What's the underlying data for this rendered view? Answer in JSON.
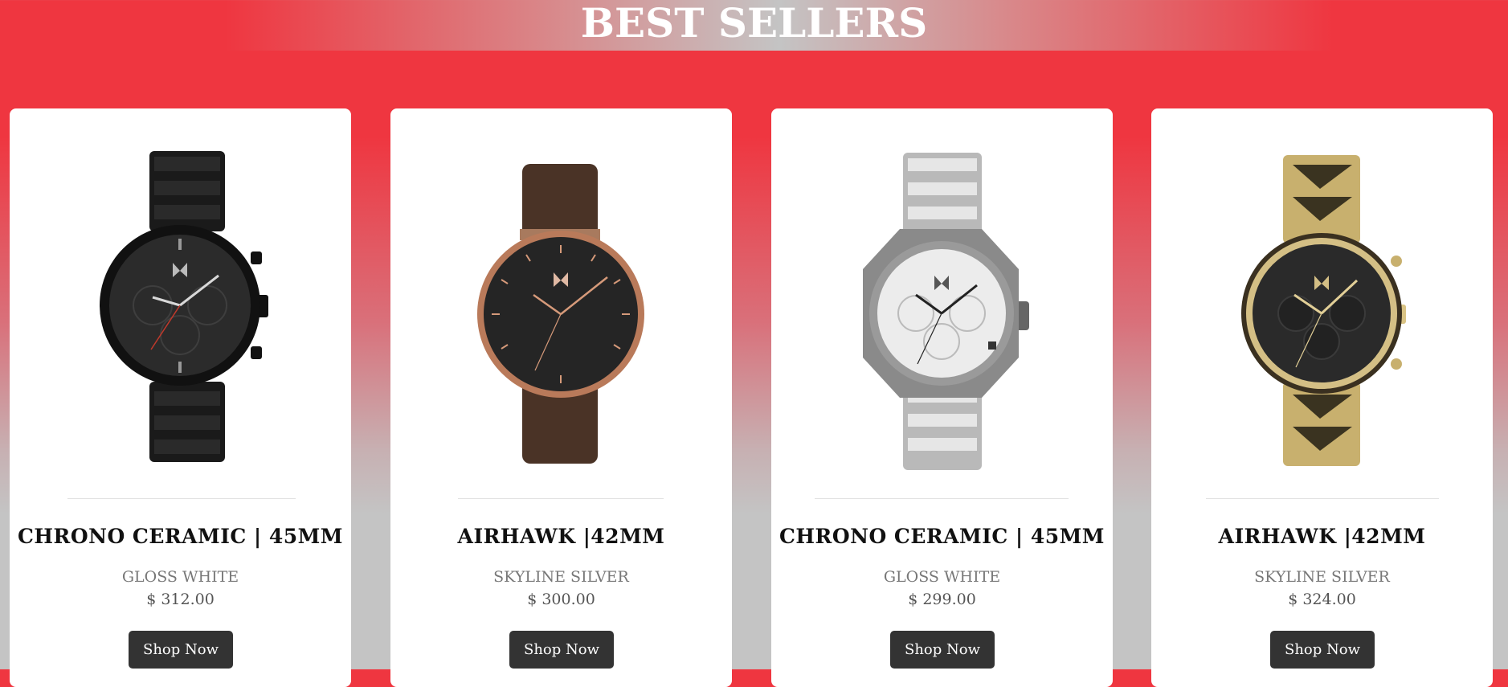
{
  "header": {
    "title": "BEST SELLERS"
  },
  "products": [
    {
      "name": "CHRONO CERAMIC | 45MM",
      "variant": "GLOSS WHITE",
      "price": "$ 312.00",
      "button": "Shop Now",
      "image": "black-chronograph-watch"
    },
    {
      "name": "AIRHAWK |42MM",
      "variant": "SKYLINE SILVER",
      "price": "$ 300.00",
      "button": "Shop Now",
      "image": "rose-gold-leather-watch"
    },
    {
      "name": "CHRONO CERAMIC | 45MM",
      "variant": "GLOSS WHITE",
      "price": "$ 299.00",
      "button": "Shop Now",
      "image": "silver-chronograph-watch"
    },
    {
      "name": "AIRHAWK |42MM",
      "variant": "SKYLINE SILVER",
      "price": "$ 324.00",
      "button": "Shop Now",
      "image": "gold-chronograph-watch"
    }
  ],
  "colors": {
    "top_red": "#ef3640",
    "bottom_gray": "#c4c4c4",
    "button": "#333333",
    "card": "#ffffff"
  }
}
